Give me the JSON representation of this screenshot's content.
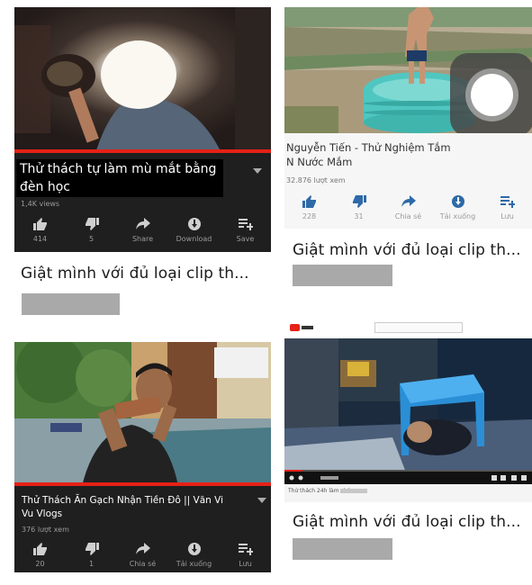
{
  "videos": [
    {
      "title": "Thử thách tự làm mù mắt bằng đèn học",
      "views": "1,4K views",
      "actions": [
        {
          "label": "414",
          "icon": "thumbs-up-icon"
        },
        {
          "label": "5",
          "icon": "thumbs-down-icon"
        },
        {
          "label": "Share",
          "icon": "share-icon"
        },
        {
          "label": "Download",
          "icon": "download-icon"
        },
        {
          "label": "Save",
          "icon": "save-to-playlist-icon"
        }
      ]
    },
    {
      "title": "Nguyễn Tiến - Thử Nghiệm Tắm N Nước Mắm",
      "views": "32.876 lượt xem",
      "actions": [
        {
          "label": "228",
          "icon": "thumbs-up-icon"
        },
        {
          "label": "31",
          "icon": "thumbs-down-icon"
        },
        {
          "label": "Chia sẻ",
          "icon": "share-icon"
        },
        {
          "label": "Tải xuống",
          "icon": "download-icon"
        },
        {
          "label": "Lưu",
          "icon": "save-to-playlist-icon"
        }
      ]
    },
    {
      "title": "Thử Thách Ăn Gạch Nhận Tiền Đô || Văn Vi Vu Vlogs",
      "views": "376 lượt xem",
      "actions": [
        {
          "label": "20",
          "icon": "thumbs-up-icon"
        },
        {
          "label": "1",
          "icon": "thumbs-down-icon"
        },
        {
          "label": "Chia sẻ",
          "icon": "share-icon"
        },
        {
          "label": "Tải xuống",
          "icon": "download-icon"
        },
        {
          "label": "Lưu",
          "icon": "save-to-playlist-icon"
        }
      ]
    },
    {
      "title": "Thử thách 24h làm chó"
    }
  ],
  "caption": "Giật mình với đủ loại clip th...",
  "colors": {
    "dark_panel": "#1f1f1f",
    "progress_red": "#e62117",
    "pool_teal": "#4fc7c0",
    "stool_blue": "#2a8fd6",
    "light_panel": "#f6f6f6"
  }
}
